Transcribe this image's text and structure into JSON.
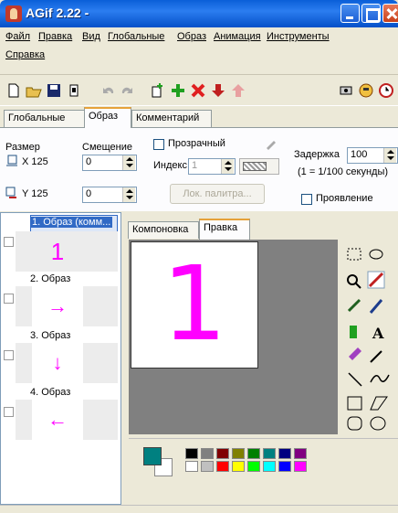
{
  "window": {
    "title": "AGif 2.22 -"
  },
  "menu": {
    "items": [
      "Файл",
      "Правка",
      "Вид",
      "Глобальные",
      "Образ",
      "Анимация",
      "Инструменты",
      "Справка"
    ]
  },
  "toolbar": {
    "icons": [
      "new-icon",
      "open-icon",
      "save-icon",
      "clip-icon",
      "undo-icon",
      "redo-icon",
      "add-frame-icon",
      "insert-icon",
      "delete-icon",
      "move-down-icon",
      "move-up-icon",
      "preview-icon",
      "hand-icon",
      "timer-icon"
    ]
  },
  "tabs": {
    "global": "Глобальные",
    "image": "Образ",
    "comment": "Комментарий"
  },
  "image_panel": {
    "size_label": "Размер",
    "offset_label": "Смещение",
    "x_label": "X",
    "x_value": "125",
    "offset_x": "0",
    "y_label": "Y",
    "y_value": "125",
    "offset_y": "0",
    "transparent_label": "Прозрачный",
    "index_label": "Индекс",
    "index_value": "1",
    "local_palette_button": "Лок. палитра...",
    "delay_label": "Задержка",
    "delay_value": "100",
    "delay_hint": "(1 = 1/100 секунды)",
    "appearance_label": "Проявление"
  },
  "frames": [
    {
      "label": "1. Образ (комм...",
      "glyph": "1"
    },
    {
      "label": "2. Образ",
      "glyph": "→"
    },
    {
      "label": "3. Образ",
      "glyph": "↓"
    },
    {
      "label": "4. Образ",
      "glyph": "←"
    }
  ],
  "editor_tabs": {
    "layout": "Компоновка",
    "edit": "Правка"
  },
  "canvas": {
    "glyph": "1",
    "color": "#ff00ff"
  },
  "colors": {
    "foreground": "#008080",
    "background": "#ffffff",
    "accent": "#ff00ff"
  },
  "palette": {
    "row1": [
      "#000000",
      "#808080",
      "#800000",
      "#808000",
      "#008000",
      "#008080",
      "#000080",
      "#800080"
    ],
    "row2": [
      "#ffffff",
      "#c0c0c0",
      "#ff0000",
      "#ffff00",
      "#00ff00",
      "#00ffff",
      "#0000ff",
      "#ff00ff"
    ]
  },
  "drawing_tools": {
    "text_tool_glyph": "A"
  }
}
